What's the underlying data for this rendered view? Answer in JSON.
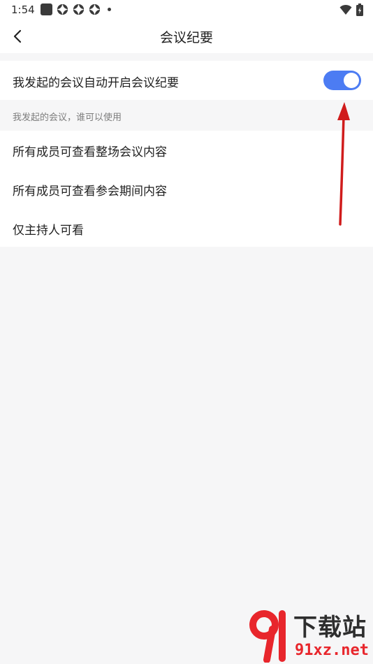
{
  "status_bar": {
    "time": "1:54",
    "icons_left": [
      "app-square-icon",
      "ring-icon",
      "ring-icon",
      "ring-icon",
      "dot-icon"
    ],
    "icons_right": [
      "wifi-icon",
      "battery-icon"
    ]
  },
  "nav": {
    "title": "会议纪要",
    "back_icon": "chevron-left-icon"
  },
  "auto_minutes": {
    "label": "我发起的会议自动开启会议纪要",
    "enabled": true
  },
  "section_caption": "我发起的会议，谁可以使用",
  "options": [
    {
      "label": "所有成员可查看整场会议内容"
    },
    {
      "label": "所有成员可查看参会期间内容"
    },
    {
      "label": "仅主持人可看"
    }
  ],
  "colors": {
    "accent": "#4c7cf3",
    "background": "#f6f6f7",
    "annotation_arrow": "#d01c1c"
  },
  "watermark": {
    "title": "下载站",
    "site": "91xz.net"
  }
}
